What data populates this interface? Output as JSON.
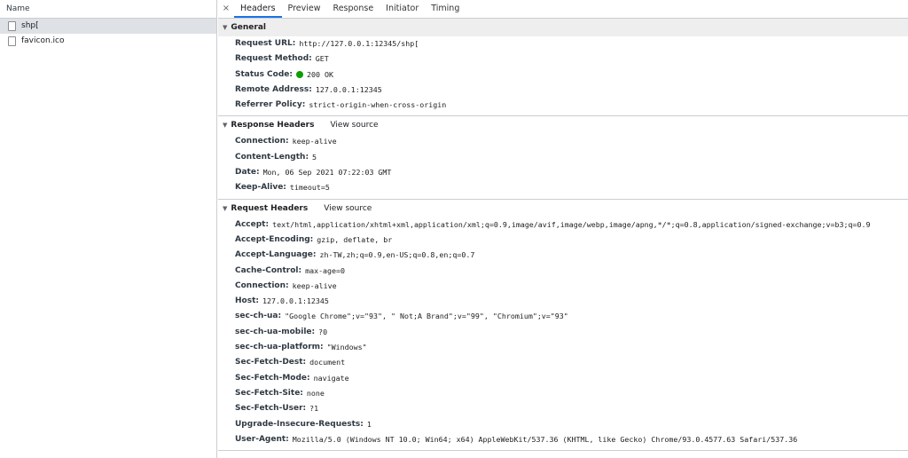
{
  "left": {
    "header": "Name",
    "requests": [
      {
        "name": "shp[",
        "selected": true
      },
      {
        "name": "favicon.ico",
        "selected": false
      }
    ]
  },
  "tabs": {
    "close": "×",
    "items": [
      "Headers",
      "Preview",
      "Response",
      "Initiator",
      "Timing"
    ]
  },
  "general": {
    "title": "General",
    "rows": [
      {
        "key": "Request URL:",
        "value": "http://127.0.0.1:12345/shp["
      },
      {
        "key": "Request Method:",
        "value": "GET"
      },
      {
        "key": "Status Code:",
        "value": "200 OK"
      },
      {
        "key": "Remote Address:",
        "value": "127.0.0.1:12345"
      },
      {
        "key": "Referrer Policy:",
        "value": "strict-origin-when-cross-origin"
      }
    ]
  },
  "response_headers": {
    "title": "Response Headers",
    "view_source": "View source",
    "rows": [
      {
        "key": "Connection:",
        "value": "keep-alive"
      },
      {
        "key": "Content-Length:",
        "value": "5"
      },
      {
        "key": "Date:",
        "value": "Mon, 06 Sep 2021 07:22:03 GMT"
      },
      {
        "key": "Keep-Alive:",
        "value": "timeout=5"
      }
    ]
  },
  "request_headers": {
    "title": "Request Headers",
    "view_source": "View source",
    "rows": [
      {
        "key": "Accept:",
        "value": "text/html,application/xhtml+xml,application/xml;q=0.9,image/avif,image/webp,image/apng,*/*;q=0.8,application/signed-exchange;v=b3;q=0.9"
      },
      {
        "key": "Accept-Encoding:",
        "value": "gzip, deflate, br"
      },
      {
        "key": "Accept-Language:",
        "value": "zh-TW,zh;q=0.9,en-US;q=0.8,en;q=0.7"
      },
      {
        "key": "Cache-Control:",
        "value": "max-age=0"
      },
      {
        "key": "Connection:",
        "value": "keep-alive"
      },
      {
        "key": "Host:",
        "value": "127.0.0.1:12345"
      },
      {
        "key": "sec-ch-ua:",
        "value": "\"Google Chrome\";v=\"93\", \" Not;A Brand\";v=\"99\", \"Chromium\";v=\"93\""
      },
      {
        "key": "sec-ch-ua-mobile:",
        "value": "?0"
      },
      {
        "key": "sec-ch-ua-platform:",
        "value": "\"Windows\""
      },
      {
        "key": "Sec-Fetch-Dest:",
        "value": "document"
      },
      {
        "key": "Sec-Fetch-Mode:",
        "value": "navigate"
      },
      {
        "key": "Sec-Fetch-Site:",
        "value": "none"
      },
      {
        "key": "Sec-Fetch-User:",
        "value": "?1"
      },
      {
        "key": "Upgrade-Insecure-Requests:",
        "value": "1"
      },
      {
        "key": "User-Agent:",
        "value": "Mozilla/5.0 (Windows NT 10.0; Win64; x64) AppleWebKit/537.36 (KHTML, like Gecko) Chrome/93.0.4577.63 Safari/537.36"
      }
    ]
  },
  "colors": {
    "accent": "#1a73e8",
    "status_ok": "#0a9e01",
    "selected_row": "#dee1e6"
  }
}
